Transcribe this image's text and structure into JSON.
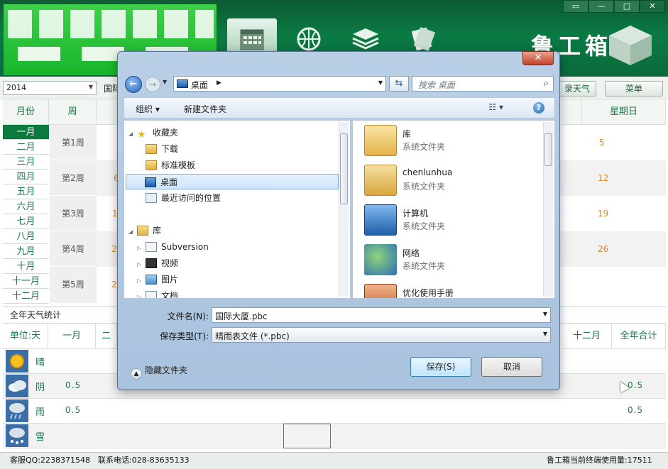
{
  "window": {
    "brand": "鲁工箱",
    "controls": [
      "▭",
      "—",
      "□",
      "✕"
    ]
  },
  "toolbar": {
    "year": "2014",
    "site": "国际",
    "btn_weather": "录天气",
    "btn_menu": "菜单"
  },
  "calendar": {
    "header_month": "月份",
    "header_week": "周",
    "header_sat": "星期日",
    "months": [
      "一月",
      "二月",
      "三月",
      "四月",
      "五月",
      "六月",
      "七月",
      "八月",
      "九月",
      "十月",
      "十一月",
      "十二月"
    ],
    "weeks": [
      "第1周",
      "第2周",
      "第3周",
      "第4周",
      "第5周"
    ],
    "partial_days": [
      "6",
      "1",
      "2",
      "2"
    ],
    "sundays": [
      "5",
      "12",
      "19",
      "26"
    ]
  },
  "stats": {
    "title": "全年天气统计",
    "unit_header": "单位:天",
    "col_jan": "一月",
    "col_feb": "二",
    "col_dec": "十二月",
    "col_total": "全年合计",
    "rows": [
      {
        "label": "晴",
        "jan": "",
        "total": ""
      },
      {
        "label": "阴",
        "jan": "0.5",
        "total": "0.5"
      },
      {
        "label": "雨",
        "jan": "0.5",
        "total": "0.5"
      },
      {
        "label": "雪",
        "jan": "",
        "total": ""
      }
    ]
  },
  "status": {
    "qq": "客服QQ:2238371548",
    "phone": "联系电话:028-83635133",
    "usage": "鲁工箱当前终端使用量:17511"
  },
  "dialog": {
    "address": "桌面",
    "search_placeholder": "搜索 桌面",
    "organize": "组织 ▾",
    "new_folder": "新建文件夹",
    "tree": {
      "favorites": "收藏夹",
      "downloads": "下载",
      "templates": "标准模板",
      "desktop": "桌面",
      "recent": "最近访问的位置",
      "libraries": "库",
      "subversion": "Subversion",
      "videos": "视频",
      "pictures": "图片",
      "documents": "文档"
    },
    "files": [
      {
        "name": "库",
        "type": "系统文件夹"
      },
      {
        "name": "chenlunhua",
        "type": "系统文件夹"
      },
      {
        "name": "计算机",
        "type": "系统文件夹"
      },
      {
        "name": "网络",
        "type": "系统文件夹"
      },
      {
        "name": "优化使用手册",
        "type": ""
      }
    ],
    "filename_label": "文件名(N):",
    "filename_value": "国际大厦.pbc",
    "filetype_label": "保存类型(T):",
    "filetype_value": "晴雨表文件 (*.pbc)",
    "hide_folders": "隐藏文件夹",
    "save": "保存(S)",
    "cancel": "取消"
  }
}
